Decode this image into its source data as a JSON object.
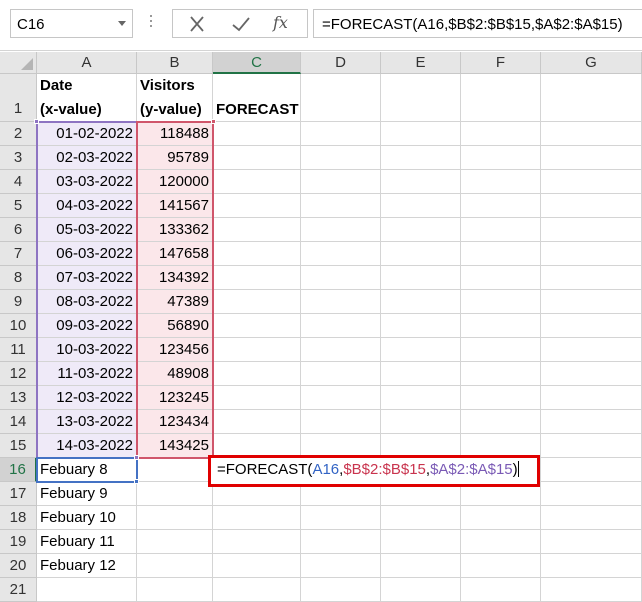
{
  "name_box": "C16",
  "formula_bar": "=FORECAST(A16,$B$2:$B$15,$A$2:$A$15)",
  "column_headers": [
    "A",
    "B",
    "C",
    "D",
    "E",
    "F",
    "G"
  ],
  "row_headers": [
    "1",
    "2",
    "3",
    "4",
    "5",
    "6",
    "7",
    "8",
    "9",
    "10",
    "11",
    "12",
    "13",
    "14",
    "15",
    "16",
    "17",
    "18",
    "19",
    "20",
    "21"
  ],
  "header_row": {
    "a_line1": "Date",
    "a_line2": "(x-value)",
    "b_line1": "Visitors",
    "b_line2": "(y-value)",
    "c": "FORECAST"
  },
  "data_rows": [
    {
      "date": "01-02-2022",
      "visitors": "118488"
    },
    {
      "date": "02-03-2022",
      "visitors": "95789"
    },
    {
      "date": "03-03-2022",
      "visitors": "120000"
    },
    {
      "date": "04-03-2022",
      "visitors": "141567"
    },
    {
      "date": "05-03-2022",
      "visitors": "133362"
    },
    {
      "date": "06-03-2022",
      "visitors": "147658"
    },
    {
      "date": "07-03-2022",
      "visitors": "134392"
    },
    {
      "date": "08-03-2022",
      "visitors": "47389"
    },
    {
      "date": "09-03-2022",
      "visitors": "56890"
    },
    {
      "date": "10-03-2022",
      "visitors": "123456"
    },
    {
      "date": "11-03-2022",
      "visitors": "48908"
    },
    {
      "date": "12-03-2022",
      "visitors": "123245"
    },
    {
      "date": "13-03-2022",
      "visitors": "123434"
    },
    {
      "date": "14-03-2022",
      "visitors": "143425"
    }
  ],
  "forecast_dates": [
    "Febuary 8",
    "Febuary 9",
    "Febuary 10",
    "Febuary 11",
    "Febuary 12"
  ],
  "editing_formula": {
    "prefix": "=FORECAST(",
    "arg1": "A16",
    "sep1": ",",
    "arg2": "$B$2:$B$15",
    "sep2": ",",
    "arg3": "$A$2:$A$15",
    "suffix": ")"
  },
  "colors": {
    "ref_a16": "#4472c4",
    "ref_b_range": "#d0566b",
    "ref_a_range": "#8e74c2",
    "highlight_border": "#e00000"
  }
}
